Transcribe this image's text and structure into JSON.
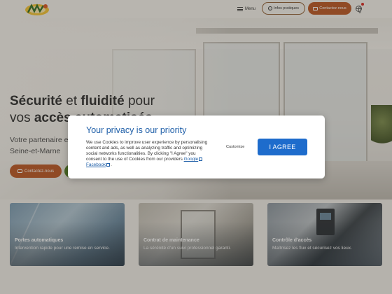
{
  "header": {
    "logo_alt": "AWS",
    "menu_label": "Menu",
    "info_label": "Infos pratiques",
    "contact_label": "Contactez-nous"
  },
  "hero": {
    "title_line1_bold": "Sécurité",
    "title_line1_mid": " et ",
    "title_line1_bold2": "fluidité",
    "title_line1_end": " pour",
    "title_line2_start": "vos ",
    "title_line2_bold": "accès automatisés",
    "subtitle_line1": "Votre partenaire e",
    "subtitle_line2": "Seine-et-Marne",
    "contact_label": "Contactez-nous"
  },
  "cards": [
    {
      "title": "Portes automatiques",
      "text": "Intervention rapide pour une remise en service."
    },
    {
      "title": "Contrat de maintenance",
      "text": "La sérénité d'un suivi professionnel garanti."
    },
    {
      "title": "Contrôle d'accès",
      "text": "Maîtrisez les flux et sécurisez vos lieux."
    }
  ],
  "cookie_modal": {
    "title": "Your privacy is our priority",
    "body": "We use Cookies to improve user experience by personalising content and ads, as well as analyzing traffic and optimizing social networks functionalities. By clicking \"I Agree\" you consent to the use of Cookies from our providers ",
    "link_google": "Google",
    "link_facebook": "Facebook",
    "customize_label": "Customize",
    "agree_label": "I AGREE"
  },
  "colors": {
    "accent_orange": "#b9531f",
    "accent_green": "#4d7a1e",
    "modal_blue": "#1f5fa8",
    "agree_button": "#1e6ccc"
  },
  "icons": [
    "logo-icon",
    "menu-icon",
    "info-icon",
    "envelope-icon",
    "globe-icon",
    "external-link-icon"
  ]
}
